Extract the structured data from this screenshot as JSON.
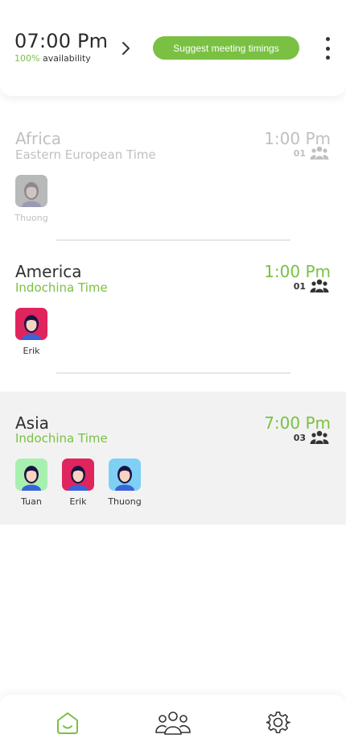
{
  "colors": {
    "accent": "#7ac143",
    "faded": "#c0c0c0",
    "text": "#2f2f2f",
    "highlight_bg": "#f2f2f2"
  },
  "header": {
    "time": "07:00 Pm",
    "availability_pct": "100%",
    "availability_label": "availability",
    "chevron_icon": "chevron-right-icon",
    "suggest_label": "Suggest meeting timings",
    "menu_icon": "more-vertical-icon"
  },
  "regions": [
    {
      "name": "Africa",
      "timezone": "Eastern European Time",
      "time": "1:00 Pm",
      "count": "01",
      "faded": true,
      "members": [
        {
          "name": "Thuong",
          "avatar_bg": "#b9b9b9"
        }
      ]
    },
    {
      "name": "America",
      "timezone": "Indochina Time",
      "time": "1:00 Pm",
      "count": "01",
      "faded": false,
      "members": [
        {
          "name": "Erik",
          "avatar_bg": "#e0245e"
        }
      ]
    },
    {
      "name": "Asia",
      "timezone": "Indochina Time",
      "time": "7:00 Pm",
      "count": "03",
      "faded": false,
      "highlighted": true,
      "members": [
        {
          "name": "Tuan",
          "avatar_bg": "#a8f0b0"
        },
        {
          "name": "Erik",
          "avatar_bg": "#e0245e"
        },
        {
          "name": "Thuong",
          "avatar_bg": "#7fd0f5"
        }
      ]
    }
  ],
  "bottom_nav": {
    "home_icon": "home-icon",
    "team_icon": "team-icon",
    "settings_icon": "settings-gear-icon",
    "active": "home"
  }
}
